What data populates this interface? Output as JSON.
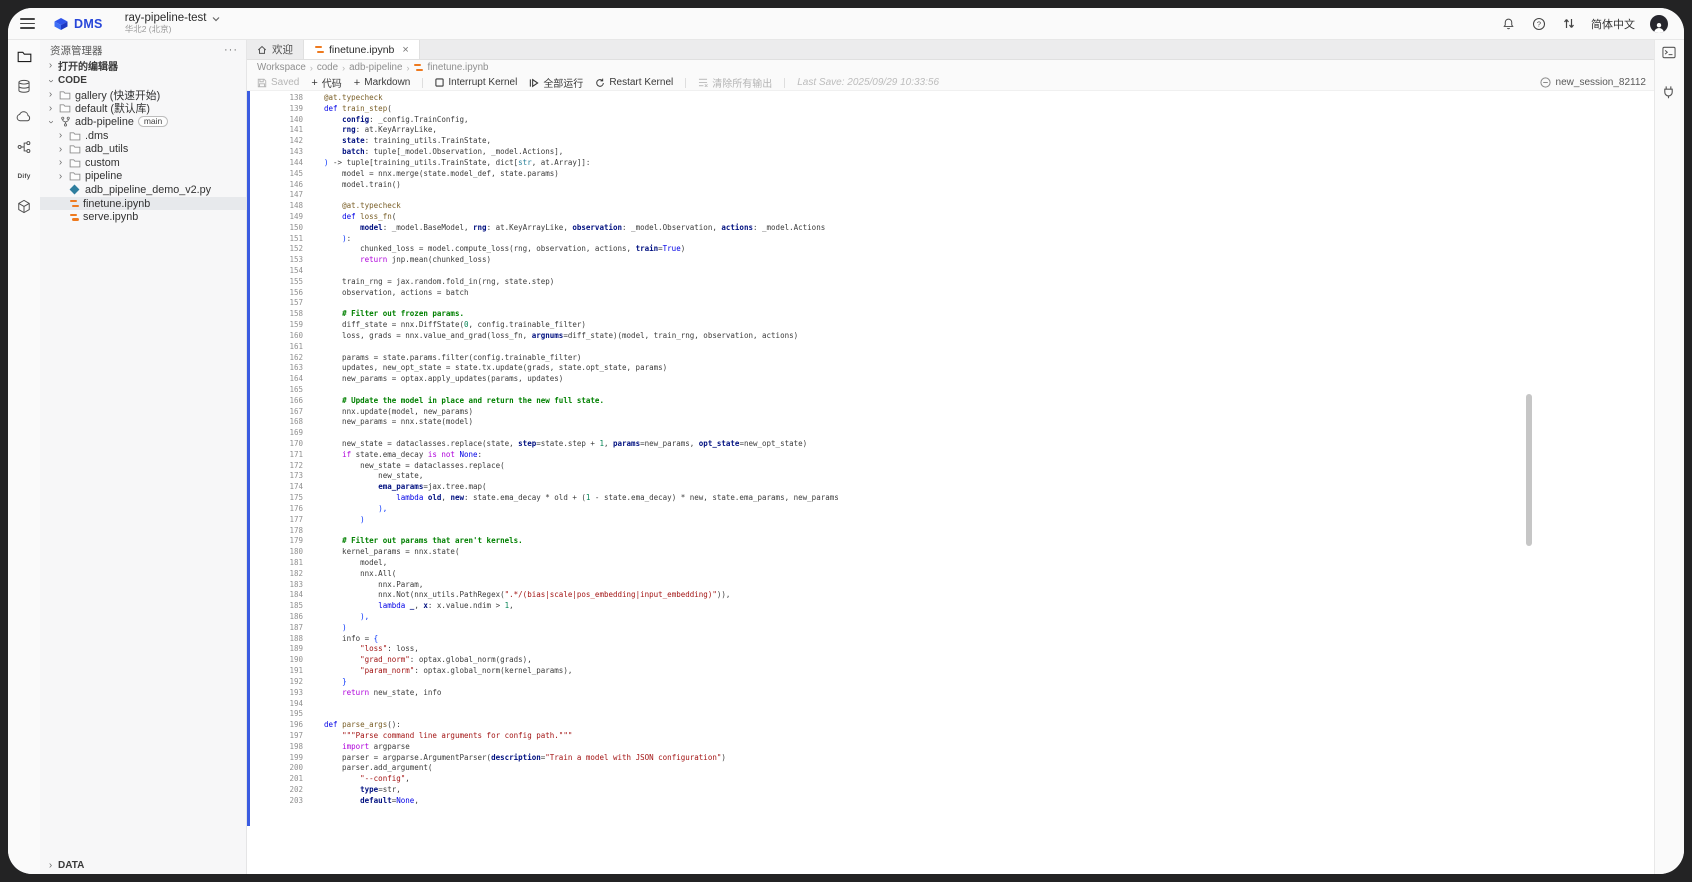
{
  "header": {
    "logo_text": "DMS",
    "workspace": {
      "name": "ray-pipeline-test",
      "region": "华北2 (北京)"
    },
    "language": "简体中文"
  },
  "icons": {
    "more": "···",
    "close": "×",
    "chevron": "›"
  },
  "colors": {
    "accent_blue": "#3b5ce1",
    "logo_blue": "#2746d9",
    "notebook_orange": "#ee7a1f",
    "python_teal": "#2e7e9e"
  },
  "sidebar": {
    "title": "资源管理器",
    "sections": {
      "open_editors": "打开的编辑器",
      "code": "CODE",
      "data": "DATA"
    },
    "tree": [
      {
        "label": "gallery (快速开始)",
        "depth": 0,
        "chevron": "closed",
        "icon": "folder"
      },
      {
        "label": "default (默认库)",
        "depth": 0,
        "chevron": "closed",
        "icon": "folder"
      },
      {
        "label": "adb-pipeline",
        "depth": 0,
        "chevron": "open",
        "icon": "repo",
        "badge": "main"
      },
      {
        "label": ".dms",
        "depth": 1,
        "chevron": "closed",
        "icon": "folder"
      },
      {
        "label": "adb_utils",
        "depth": 1,
        "chevron": "closed",
        "icon": "folder"
      },
      {
        "label": "custom",
        "depth": 1,
        "chevron": "closed",
        "icon": "folder"
      },
      {
        "label": "pipeline",
        "depth": 1,
        "chevron": "closed",
        "icon": "folder"
      },
      {
        "label": "adb_pipeline_demo_v2.py",
        "depth": 1,
        "icon": "python"
      },
      {
        "label": "finetune.ipynb",
        "depth": 1,
        "icon": "notebook",
        "selected": true
      },
      {
        "label": "serve.ipynb",
        "depth": 1,
        "icon": "notebook"
      }
    ]
  },
  "tabs": [
    {
      "label": "欢迎",
      "active": false
    },
    {
      "label": "finetune.ipynb",
      "active": true
    }
  ],
  "breadcrumb": {
    "items": [
      "Workspace",
      "code",
      "adb-pipeline",
      "finetune.ipynb"
    ]
  },
  "toolbar": {
    "saved": "Saved",
    "add_code": "代码",
    "add_markdown": "Markdown",
    "interrupt": "Interrupt Kernel",
    "run_all": "全部运行",
    "restart": "Restart Kernel",
    "clear_outputs": "清除所有输出",
    "last_save": "Last Save: 2025/09/29 10:33:56"
  },
  "session": {
    "name": "new_session_82112"
  },
  "editor": {
    "filename": "finetune.ipynb",
    "lines": [
      {
        "n": 138,
        "t": [
          [
            "f",
            "@at.typecheck"
          ]
        ]
      },
      {
        "n": 139,
        "t": [
          [
            "k",
            "def "
          ],
          [
            "f",
            "train_step"
          ],
          [
            "p",
            "("
          ]
        ]
      },
      {
        "n": 140,
        "t": [
          [
            "p",
            "    "
          ],
          [
            "v",
            "config"
          ],
          [
            "p",
            ": _config.TrainConfig,"
          ]
        ]
      },
      {
        "n": 141,
        "t": [
          [
            "p",
            "    "
          ],
          [
            "v",
            "rng"
          ],
          [
            "p",
            ": at.KeyArrayLike,"
          ]
        ]
      },
      {
        "n": 142,
        "t": [
          [
            "p",
            "    "
          ],
          [
            "v",
            "state"
          ],
          [
            "p",
            ": training_utils.TrainState,"
          ]
        ]
      },
      {
        "n": 143,
        "t": [
          [
            "p",
            "    "
          ],
          [
            "v",
            "batch"
          ],
          [
            "p",
            ": tuple[_model.Observation, _model.Actions],"
          ]
        ]
      },
      {
        "n": 144,
        "t": [
          [
            "b",
            ") "
          ],
          [
            "p",
            "-> tuple[training_utils.TrainState, dict["
          ],
          [
            "t",
            "str"
          ],
          [
            "p",
            ", at.Array]]:"
          ]
        ]
      },
      {
        "n": 145,
        "t": [
          [
            "p",
            "    model = nnx.merge(state.model_def, state.params)"
          ]
        ]
      },
      {
        "n": 146,
        "t": [
          [
            "p",
            "    model.train()"
          ]
        ]
      },
      {
        "n": 147,
        "t": []
      },
      {
        "n": 148,
        "t": [
          [
            "p",
            "    "
          ],
          [
            "f",
            "@at.typecheck"
          ]
        ]
      },
      {
        "n": 149,
        "t": [
          [
            "p",
            "    "
          ],
          [
            "k",
            "def "
          ],
          [
            "f",
            "loss_fn"
          ],
          [
            "p",
            "("
          ]
        ]
      },
      {
        "n": 150,
        "t": [
          [
            "p",
            "        "
          ],
          [
            "v",
            "model"
          ],
          [
            "p",
            ": _model.BaseModel, "
          ],
          [
            "v",
            "rng"
          ],
          [
            "p",
            ": at.KeyArrayLike, "
          ],
          [
            "v",
            "observation"
          ],
          [
            "p",
            ": _model.Observation, "
          ],
          [
            "v",
            "actions"
          ],
          [
            "p",
            ": _model.Actions"
          ]
        ]
      },
      {
        "n": 151,
        "t": [
          [
            "p",
            "    "
          ],
          [
            "b",
            ")"
          ],
          [
            "p",
            ":"
          ]
        ]
      },
      {
        "n": 152,
        "t": [
          [
            "p",
            "        chunked_loss = model.compute_loss(rng, observation, actions, "
          ],
          [
            "v",
            "train"
          ],
          [
            "p",
            "="
          ],
          [
            "k",
            "True"
          ],
          [
            "p",
            ")"
          ]
        ]
      },
      {
        "n": 153,
        "t": [
          [
            "p",
            "        "
          ],
          [
            "c",
            "return "
          ],
          [
            "p",
            "jnp.mean(chunked_loss)"
          ]
        ]
      },
      {
        "n": 154,
        "t": []
      },
      {
        "n": 155,
        "t": [
          [
            "p",
            "    train_rng = jax.random.fold_in(rng, state.step)"
          ]
        ]
      },
      {
        "n": 156,
        "t": [
          [
            "p",
            "    observation, actions = batch"
          ]
        ]
      },
      {
        "n": 157,
        "t": []
      },
      {
        "n": 158,
        "t": [
          [
            "p",
            "    "
          ],
          [
            "m",
            "# Filter out frozen params."
          ]
        ]
      },
      {
        "n": 159,
        "t": [
          [
            "p",
            "    diff_state = nnx.DiffState("
          ],
          [
            "n2",
            "0"
          ],
          [
            "p",
            ", config.trainable_filter)"
          ]
        ]
      },
      {
        "n": 160,
        "t": [
          [
            "p",
            "    loss, grads = nnx.value_and_grad(loss_fn, "
          ],
          [
            "v",
            "argnums"
          ],
          [
            "p",
            "=diff_state)(model, train_rng, observation, actions)"
          ]
        ]
      },
      {
        "n": 161,
        "t": []
      },
      {
        "n": 162,
        "t": [
          [
            "p",
            "    params = state.params.filter(config.trainable_filter)"
          ]
        ]
      },
      {
        "n": 163,
        "t": [
          [
            "p",
            "    updates, new_opt_state = state.tx.update(grads, state.opt_state, params)"
          ]
        ]
      },
      {
        "n": 164,
        "t": [
          [
            "p",
            "    new_params = optax.apply_updates(params, updates)"
          ]
        ]
      },
      {
        "n": 165,
        "t": []
      },
      {
        "n": 166,
        "t": [
          [
            "p",
            "    "
          ],
          [
            "m",
            "# Update the model in place and return the new full state."
          ]
        ]
      },
      {
        "n": 167,
        "t": [
          [
            "p",
            "    nnx.update(model, new_params)"
          ]
        ]
      },
      {
        "n": 168,
        "t": [
          [
            "p",
            "    new_params = nnx.state(model)"
          ]
        ]
      },
      {
        "n": 169,
        "t": []
      },
      {
        "n": 170,
        "t": [
          [
            "p",
            "    new_state = dataclasses.replace(state, "
          ],
          [
            "v",
            "step"
          ],
          [
            "p",
            "=state.step + "
          ],
          [
            "n2",
            "1"
          ],
          [
            "p",
            ", "
          ],
          [
            "v",
            "params"
          ],
          [
            "p",
            "=new_params, "
          ],
          [
            "v",
            "opt_state"
          ],
          [
            "p",
            "=new_opt_state)"
          ]
        ]
      },
      {
        "n": 171,
        "t": [
          [
            "p",
            "    "
          ],
          [
            "c",
            "if "
          ],
          [
            "p",
            "state.ema_decay "
          ],
          [
            "c",
            "is not "
          ],
          [
            "k",
            "None"
          ],
          [
            "p",
            ":"
          ]
        ]
      },
      {
        "n": 172,
        "t": [
          [
            "p",
            "        new_state = dataclasses.replace("
          ]
        ]
      },
      {
        "n": 173,
        "t": [
          [
            "p",
            "            new_state,"
          ]
        ]
      },
      {
        "n": 174,
        "t": [
          [
            "p",
            "            "
          ],
          [
            "v",
            "ema_params"
          ],
          [
            "p",
            "=jax.tree.map("
          ]
        ]
      },
      {
        "n": 175,
        "t": [
          [
            "p",
            "                "
          ],
          [
            "k",
            "lambda "
          ],
          [
            "v",
            "old"
          ],
          [
            "p",
            ", "
          ],
          [
            "v",
            "new"
          ],
          [
            "p",
            ": state.ema_decay * old + ("
          ],
          [
            "n2",
            "1"
          ],
          [
            "p",
            " - state.ema_decay) * new, state.ema_params, new_params"
          ]
        ]
      },
      {
        "n": 176,
        "t": [
          [
            "p",
            "            "
          ],
          [
            "b",
            "),"
          ]
        ]
      },
      {
        "n": 177,
        "t": [
          [
            "p",
            "        "
          ],
          [
            "b",
            ")"
          ]
        ]
      },
      {
        "n": 178,
        "t": []
      },
      {
        "n": 179,
        "t": [
          [
            "p",
            "    "
          ],
          [
            "m",
            "# Filter out params that aren't kernels."
          ]
        ]
      },
      {
        "n": 180,
        "t": [
          [
            "p",
            "    kernel_params = nnx.state("
          ]
        ]
      },
      {
        "n": 181,
        "t": [
          [
            "p",
            "        model,"
          ]
        ]
      },
      {
        "n": 182,
        "t": [
          [
            "p",
            "        nnx.All("
          ]
        ]
      },
      {
        "n": 183,
        "t": [
          [
            "p",
            "            nnx.Param,"
          ]
        ]
      },
      {
        "n": 184,
        "t": [
          [
            "p",
            "            nnx.Not(nnx_utils.PathRegex("
          ],
          [
            "s",
            "\".*/(bias|scale|pos_embedding|input_embedding)\""
          ],
          [
            "p",
            ")),"
          ]
        ]
      },
      {
        "n": 185,
        "t": [
          [
            "p",
            "            "
          ],
          [
            "k",
            "lambda "
          ],
          [
            "v",
            "_"
          ],
          [
            "p",
            ", "
          ],
          [
            "v",
            "x"
          ],
          [
            "p",
            ": x.value.ndim > "
          ],
          [
            "n2",
            "1"
          ],
          [
            "p",
            ","
          ]
        ]
      },
      {
        "n": 186,
        "t": [
          [
            "p",
            "        "
          ],
          [
            "b",
            "),"
          ]
        ]
      },
      {
        "n": 187,
        "t": [
          [
            "p",
            "    "
          ],
          [
            "b",
            ")"
          ]
        ]
      },
      {
        "n": 188,
        "t": [
          [
            "p",
            "    info = "
          ],
          [
            "b",
            "{"
          ]
        ]
      },
      {
        "n": 189,
        "t": [
          [
            "p",
            "        "
          ],
          [
            "s",
            "\"loss\""
          ],
          [
            "p",
            ": loss,"
          ]
        ]
      },
      {
        "n": 190,
        "t": [
          [
            "p",
            "        "
          ],
          [
            "s",
            "\"grad_norm\""
          ],
          [
            "p",
            ": optax.global_norm(grads),"
          ]
        ]
      },
      {
        "n": 191,
        "t": [
          [
            "p",
            "        "
          ],
          [
            "s",
            "\"param_norm\""
          ],
          [
            "p",
            ": optax.global_norm(kernel_params),"
          ]
        ]
      },
      {
        "n": 192,
        "t": [
          [
            "p",
            "    "
          ],
          [
            "b",
            "}"
          ]
        ]
      },
      {
        "n": 193,
        "t": [
          [
            "p",
            "    "
          ],
          [
            "c",
            "return "
          ],
          [
            "p",
            "new_state, info"
          ]
        ]
      },
      {
        "n": 194,
        "t": []
      },
      {
        "n": 195,
        "t": []
      },
      {
        "n": 196,
        "t": [
          [
            "k",
            "def "
          ],
          [
            "f",
            "parse_args"
          ],
          [
            "p",
            "():"
          ]
        ]
      },
      {
        "n": 197,
        "t": [
          [
            "p",
            "    "
          ],
          [
            "s",
            "\"\"\"Parse command line arguments for config path.\"\"\""
          ]
        ]
      },
      {
        "n": 198,
        "t": [
          [
            "p",
            "    "
          ],
          [
            "c",
            "import "
          ],
          [
            "p",
            "argparse"
          ]
        ]
      },
      {
        "n": 199,
        "t": [
          [
            "p",
            "    parser = argparse.ArgumentParser("
          ],
          [
            "v",
            "description"
          ],
          [
            "p",
            "="
          ],
          [
            "s",
            "\"Train a model with JSON configuration\""
          ],
          [
            "p",
            ")"
          ]
        ]
      },
      {
        "n": 200,
        "t": [
          [
            "p",
            "    parser.add_argument("
          ]
        ]
      },
      {
        "n": 201,
        "t": [
          [
            "p",
            "        "
          ],
          [
            "s",
            "\"--config\""
          ],
          [
            "p",
            ","
          ]
        ]
      },
      {
        "n": 202,
        "t": [
          [
            "p",
            "        "
          ],
          [
            "v",
            "type"
          ],
          [
            "p",
            "=str,"
          ]
        ]
      },
      {
        "n": 203,
        "t": [
          [
            "p",
            "        "
          ],
          [
            "v",
            "default"
          ],
          [
            "p",
            "="
          ],
          [
            "k",
            "None"
          ],
          [
            "p",
            ","
          ]
        ]
      }
    ]
  }
}
